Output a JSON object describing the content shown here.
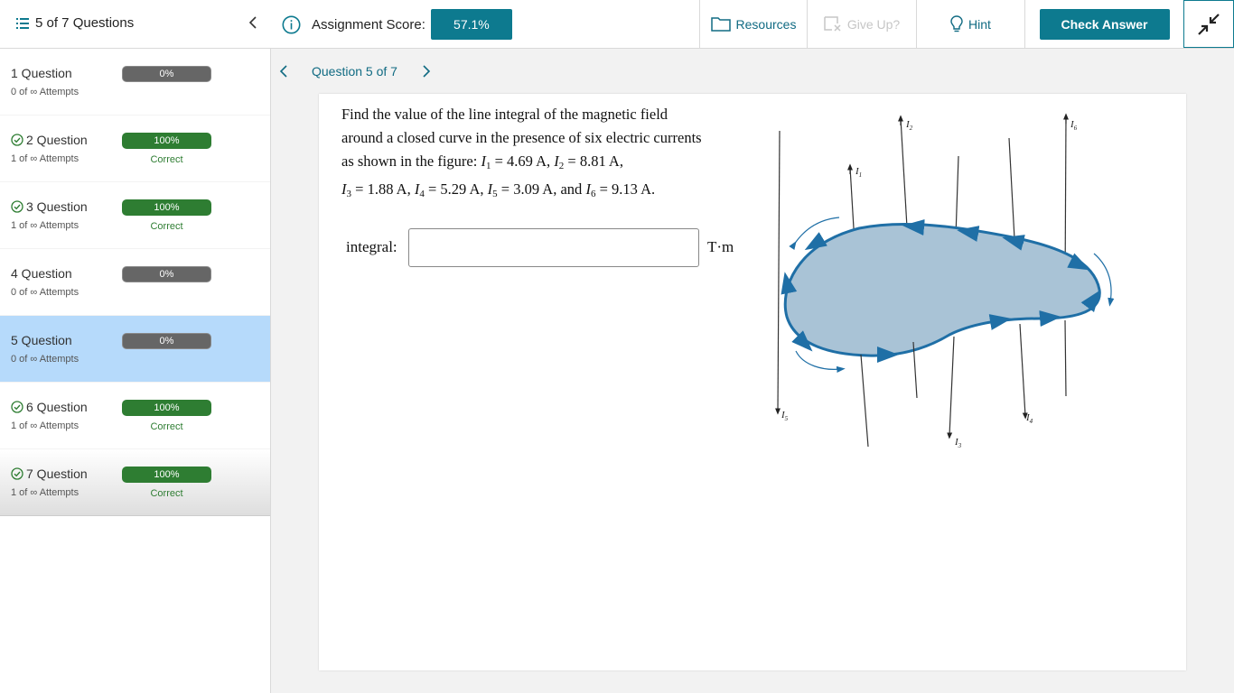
{
  "topbar": {
    "questions_toggle": "5 of 7 Questions",
    "score_label": "Assignment Score:",
    "score_value": "57.1%",
    "resources_label": "Resources",
    "giveup_label": "Give Up?",
    "hint_label": "Hint",
    "check_label": "Check Answer"
  },
  "sidebar": {
    "items": [
      {
        "title": "1 Question",
        "attempts": "0 of ∞ Attempts",
        "progress": "0%",
        "status": "",
        "complete": false
      },
      {
        "title": "2 Question",
        "attempts": "1 of ∞ Attempts",
        "progress": "100%",
        "status": "Correct",
        "complete": true
      },
      {
        "title": "3 Question",
        "attempts": "1 of ∞ Attempts",
        "progress": "100%",
        "status": "Correct",
        "complete": true
      },
      {
        "title": "4 Question",
        "attempts": "0 of ∞ Attempts",
        "progress": "0%",
        "status": "",
        "complete": false
      },
      {
        "title": "5 Question",
        "attempts": "0 of ∞ Attempts",
        "progress": "0%",
        "status": "",
        "complete": false
      },
      {
        "title": "6 Question",
        "attempts": "1 of ∞ Attempts",
        "progress": "100%",
        "status": "Correct",
        "complete": true
      },
      {
        "title": "7 Question",
        "attempts": "1 of ∞ Attempts",
        "progress": "100%",
        "status": "Correct",
        "complete": true
      }
    ]
  },
  "question": {
    "nav_label": "Question 5 of 7",
    "prompt_line1": "Find the value of the line integral of the magnetic field",
    "prompt_line2": "around a closed curve in the presence of six electric currents",
    "prompt_line3_pre": "as shown in the figure: ",
    "currents": [
      {
        "sub": "1",
        "value": "4.69 A"
      },
      {
        "sub": "2",
        "value": "8.81 A"
      },
      {
        "sub": "3",
        "value": "1.88 A"
      },
      {
        "sub": "4",
        "value": "5.29 A"
      },
      {
        "sub": "5",
        "value": "3.09 A"
      },
      {
        "sub": "6",
        "value": "9.13 A"
      }
    ],
    "answer_label": "integral:",
    "answer_value": "",
    "answer_unit": "T·m"
  },
  "colors": {
    "accent": "#0d7a8f",
    "active_row": "#b6dafb",
    "success": "#2e7d32",
    "link": "#116b83",
    "region_fill": "#a9c3d6",
    "curve": "#1f6fa6"
  }
}
